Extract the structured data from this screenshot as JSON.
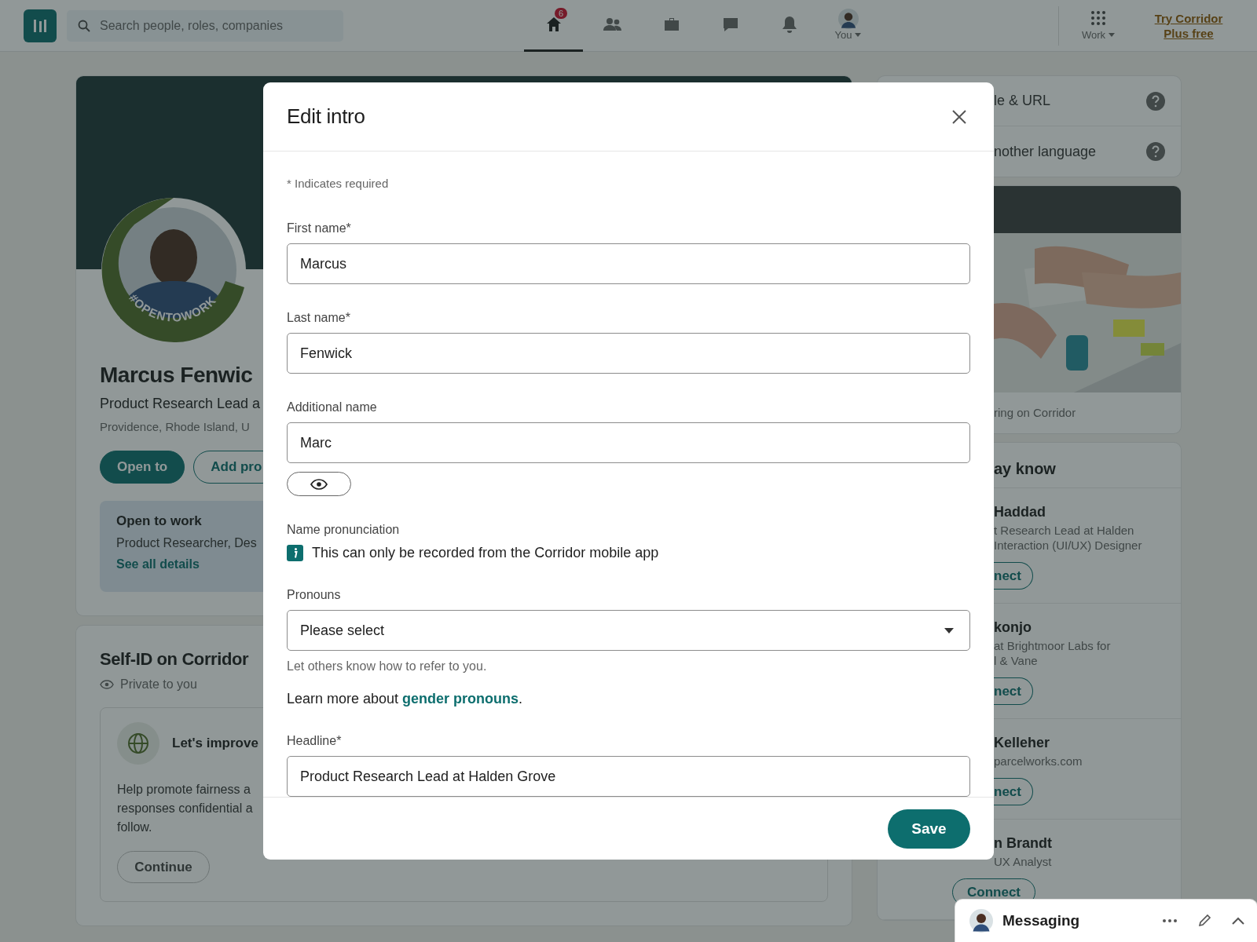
{
  "top_bar": {
    "search": {
      "placeholder": "Search people, roles, companies"
    },
    "nav": [
      {
        "kind": "home",
        "badge": "6",
        "selected": true
      },
      {
        "kind": "network",
        "selected": false
      },
      {
        "kind": "jobs",
        "selected": false
      },
      {
        "kind": "messaging",
        "selected": false
      },
      {
        "kind": "notifications",
        "selected": false
      },
      {
        "kind": "me",
        "label": "You",
        "selected": false,
        "dropdown": true
      }
    ],
    "work": {
      "label": "Work",
      "dropdown": true
    },
    "upsell": "Try Corridor Plus free"
  },
  "profile": {
    "frame_label": "#OPENTOWORK",
    "name": "Marcus Fenwic",
    "headline": "Product Research Lead a",
    "location": "Providence, Rhode Island, U",
    "buttons": [
      {
        "label": "Open to",
        "kind": "primary"
      },
      {
        "label": "Add pro",
        "kind": "outline"
      }
    ],
    "open_to_work": {
      "title": "Open to work",
      "text": "Product Researcher, Des",
      "link": "See all details"
    }
  },
  "self_id": {
    "title": "Self-ID on Corridor",
    "privacy": "Private to you",
    "prompt": {
      "title": "Let's improve",
      "lines": [
        "Help promote fairness a",
        "responses confidential a",
        "follow."
      ],
      "button": "Continue"
    }
  },
  "right": {
    "settings": [
      {
        "label": "le & URL"
      },
      {
        "label": "nother language"
      }
    ],
    "ad": {
      "kind": "picture",
      "caption": "ring on Corridor"
    },
    "people": {
      "title": "ay know",
      "items": [
        {
          "name": "Haddad",
          "lines": [
            "t Research Lead at Halden",
            "Interaction (UI/UX) Designer"
          ],
          "button": "nect"
        },
        {
          "name": "konjo",
          "lines": [
            "at Brightmoor Labs for",
            "l & Vane"
          ],
          "button": "nect"
        },
        {
          "name": "Kelleher",
          "lines": [
            "parcelworks.com"
          ],
          "button": "nect"
        },
        {
          "name": "n Brandt",
          "lines": [
            "UX Analyst"
          ],
          "button": "Connect"
        }
      ]
    }
  },
  "modal": {
    "title": "Edit intro",
    "required_note": "* Indicates required",
    "fields": [
      {
        "kind": "text",
        "label": "First name*",
        "value": "Marcus"
      },
      {
        "kind": "text",
        "label": "Last name*",
        "value": "Fenwick"
      },
      {
        "kind": "text",
        "label": "Additional name",
        "value": "Marc",
        "visibility_toggle": true
      },
      {
        "kind": "note",
        "label": "Name pronunciation",
        "note": "This can only be recorded from the Corridor mobile app"
      },
      {
        "kind": "select",
        "label": "Pronouns",
        "placeholder": "Please select",
        "help": "Let others know how to refer to you.",
        "more": {
          "text": "Learn more about",
          "link": "gender pronouns",
          "end": "."
        }
      },
      {
        "kind": "text",
        "label": "Headline*",
        "value": "Product Research Lead at Halden Grove"
      }
    ],
    "save": "Save"
  },
  "messaging": {
    "title": "Messaging"
  }
}
